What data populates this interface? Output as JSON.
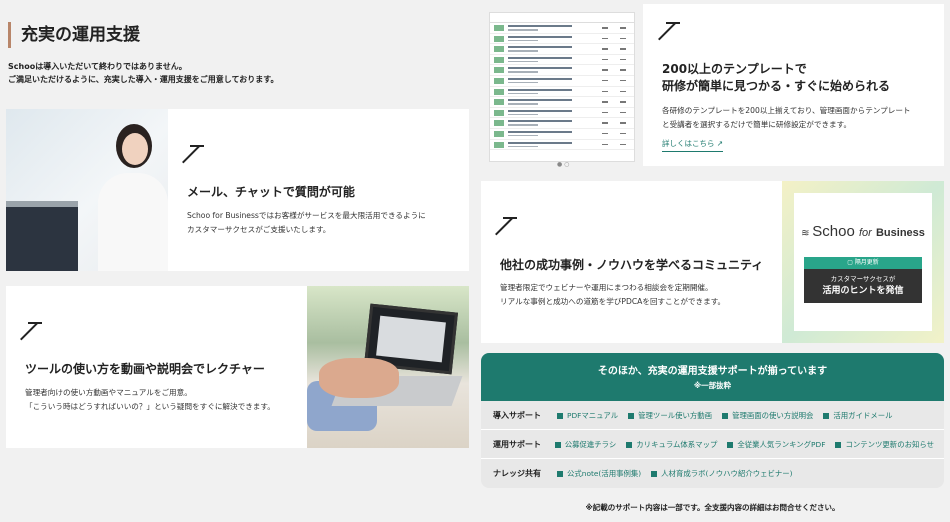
{
  "section": {
    "title": "充実の運用支援",
    "intro_lines": [
      "Schooは導入いただいて終わりではありません。",
      "ご満足いただけるように、充実した導入・運用支援をご用意しております。"
    ]
  },
  "cards": {
    "chat": {
      "title": "メール、チャットで質問が可能",
      "desc_lines": [
        "Schoo for Businessではお客様がサービスを最大限活用できるように",
        "カスタマーサクセスがご支援いたします。"
      ]
    },
    "video": {
      "title": "ツールの使い方を動画や説明会でレクチャー",
      "desc_lines": [
        "管理者向けの使い方動画やマニュアルをご用意。",
        "「こういう時はどうすればいいの？」という疑問をすぐに解決できます。"
      ]
    },
    "template": {
      "title_lines": [
        "200以上のテンプレートで",
        "研修が簡単に見つかる・すぐに始められる"
      ],
      "desc_lines": [
        "各研修のテンプレートを200以上揃えており、管理画面からテンプレート",
        "と受講者を選択するだけで簡単に研修設定ができます。"
      ],
      "link": "詳しくはこちら ↗"
    },
    "community": {
      "title": "他社の成功事例・ノウハウを学べるコミュニティ",
      "desc_lines": [
        "管理者限定でウェビナーや運用にまつわる相談会を定期開催。",
        "リアルな事例と成功への道筋を学びPDCAを回すことができます。"
      ],
      "logo_main": "Schoo",
      "logo_for": "for",
      "logo_biz": "Business",
      "tag": "隔月更新",
      "box_line1": "カスタマーサクセスが",
      "box_line2": "活用のヒントを発信"
    }
  },
  "support": {
    "heading": "そのほか、充実の運用支援サポートが揃っています",
    "subheading": "※一部抜粋",
    "rows": [
      {
        "label": "導入サポート",
        "items": [
          "PDFマニュアル",
          "管理ツール使い方動画",
          "管理画面の使い方説明会",
          "活用ガイドメール"
        ]
      },
      {
        "label": "運用サポート",
        "items": [
          "公募促進チラシ",
          "カリキュラム体系マップ",
          "全従業人気ランキングPDF",
          "コンテンツ更新のお知らせ"
        ]
      },
      {
        "label": "ナレッジ共有",
        "items": [
          "公式note(活用事例集)",
          "人材育成ラボ(ノウハウ紹介ウェビナー)"
        ]
      }
    ]
  },
  "footnote": "※記載のサポート内容は一部です。全支援内容の詳細はお問合せください。",
  "colors": {
    "accent": "#1e7a6e",
    "title_bar": "#b8866a"
  }
}
